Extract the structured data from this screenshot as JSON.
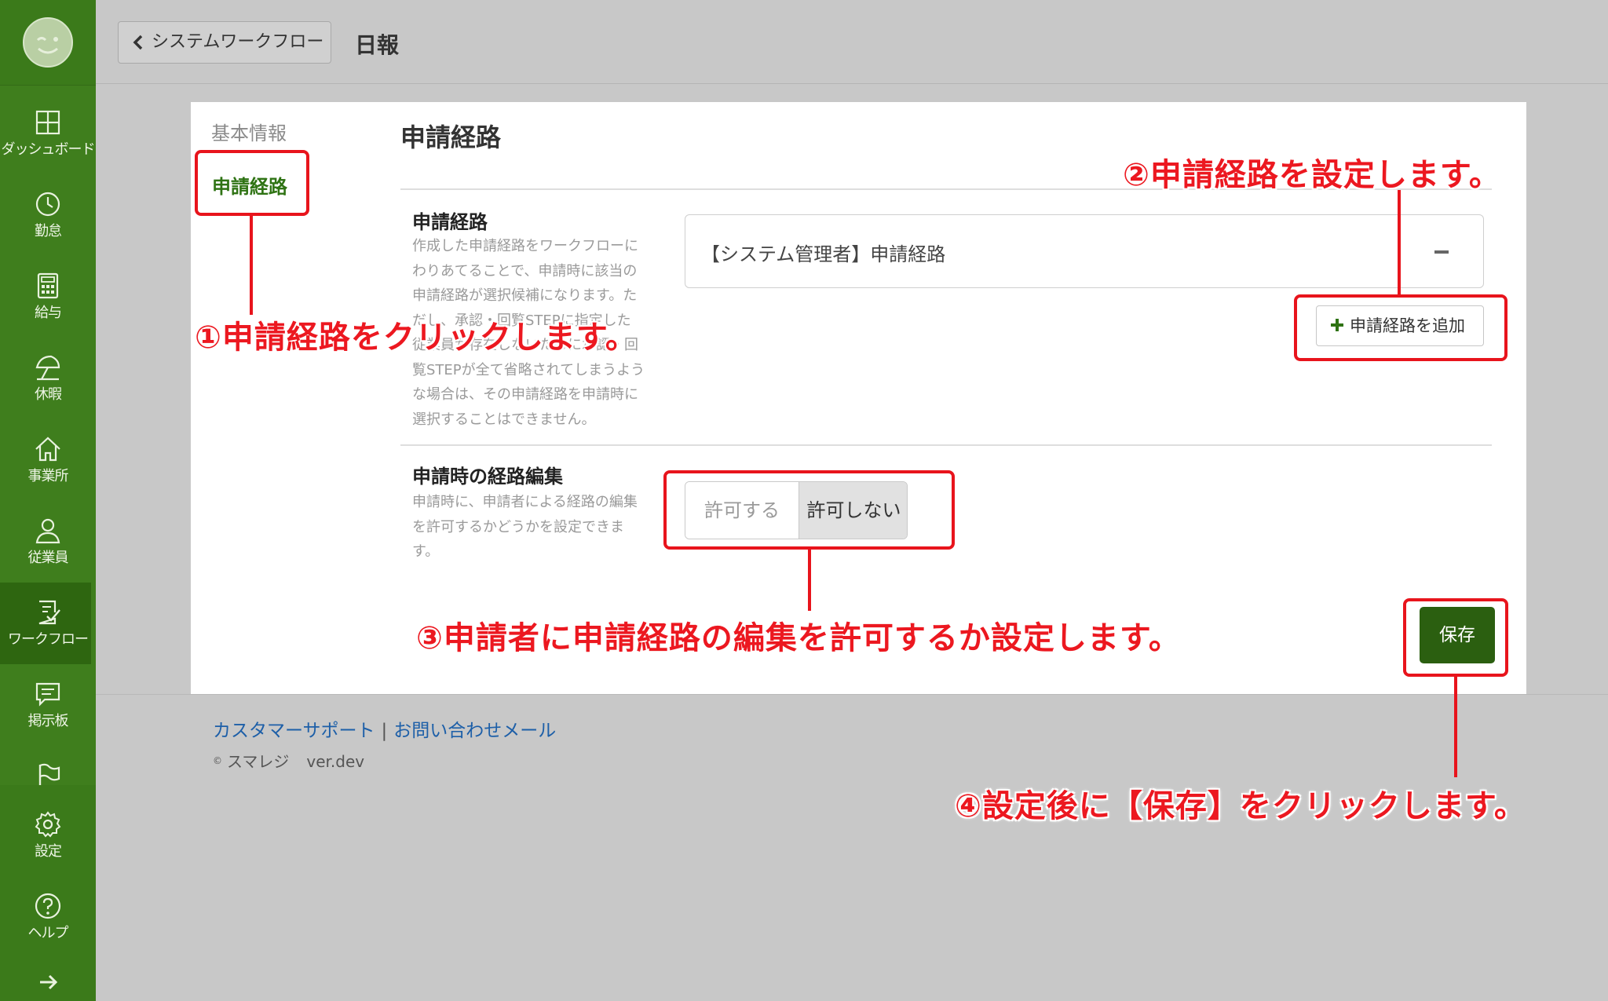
{
  "sidebar": {
    "items": [
      {
        "label": "ダッシュボード",
        "icon": "dashboard-icon"
      },
      {
        "label": "勤怠",
        "icon": "clock-icon"
      },
      {
        "label": "給与",
        "icon": "calculator-icon"
      },
      {
        "label": "休暇",
        "icon": "beach-umbrella-icon"
      },
      {
        "label": "事業所",
        "icon": "home-icon"
      },
      {
        "label": "従業員",
        "icon": "person-icon"
      },
      {
        "label": "ワークフロー",
        "icon": "checklist-icon"
      },
      {
        "label": "掲示板",
        "icon": "chat-icon"
      },
      {
        "label": "",
        "icon": "flag-icon"
      },
      {
        "label": "設定",
        "icon": "gear-icon"
      },
      {
        "label": "ヘルプ",
        "icon": "help-icon"
      },
      {
        "label": "",
        "icon": "arrow-right-icon"
      }
    ]
  },
  "header": {
    "back_label": "システムワークフロー",
    "title": "日報"
  },
  "tabs": {
    "basic": "基本情報",
    "route": "申請経路"
  },
  "main": {
    "section_title": "申請経路",
    "route_field": {
      "title": "申請経路",
      "desc_lines": [
        "作成した申請経路をワークフローに",
        "わりあてることで、申請時に該当の",
        "申請経路が選択候補になります。た",
        "だし、承認・回覧STEPに指定した",
        "従業員が存在しないために承認・回",
        "覧STEPが全て省略されてしまうよう",
        "な場合は、その申請経路を申請時に",
        "選択することはできません。"
      ],
      "selected_route": "【システム管理者】申請経路",
      "add_button": "申請経路を追加"
    },
    "edit_field": {
      "title": "申請時の経路編集",
      "desc_lines": [
        "申請時に、申請者による経路の編集",
        "を許可するかどうかを設定できま",
        "す。"
      ],
      "option_allow": "許可する",
      "option_deny": "許可しない",
      "selected": "許可しない"
    },
    "save_button": "保存"
  },
  "footer": {
    "support_link": "カスタマーサポート",
    "separator": "|",
    "mail_link": "お問い合わせメール",
    "copyright": "©",
    "company": "スマレジ",
    "version": "ver.dev"
  },
  "annotations": {
    "step1": "①申請経路をクリックします。",
    "step2": "②申請経路を設定します。",
    "step3": "③申請者に申請経路の編集を許可するか設定します。",
    "step4": "④設定後に【保存】をクリックします。",
    "color": "#e8141c"
  },
  "colors": {
    "sidebar": "#3f7e1d",
    "accent_green": "#2f7314",
    "save_button": "#2b5f10",
    "link": "#1d5fa8"
  }
}
